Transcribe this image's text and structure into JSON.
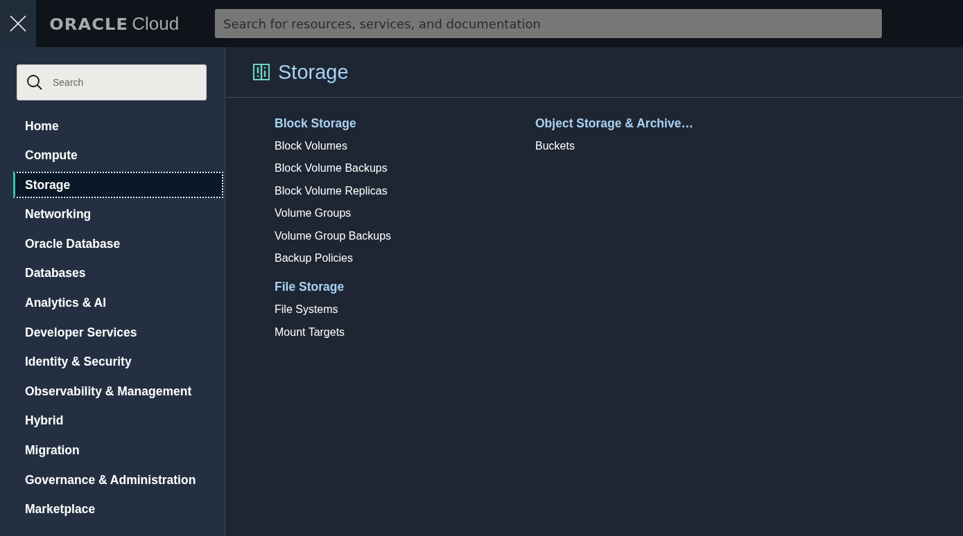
{
  "header": {
    "logo": "ORACLE",
    "product": "Cloud",
    "search": {
      "placeholder": "Search for resources, services, and documentation"
    }
  },
  "sidebar": {
    "search": {
      "placeholder": "Search"
    },
    "items": [
      {
        "label": "Home",
        "selected": false
      },
      {
        "label": "Compute",
        "selected": false
      },
      {
        "label": "Storage",
        "selected": true
      },
      {
        "label": "Networking",
        "selected": false
      },
      {
        "label": "Oracle Database",
        "selected": false
      },
      {
        "label": "Databases",
        "selected": false
      },
      {
        "label": "Analytics & AI",
        "selected": false
      },
      {
        "label": "Developer Services",
        "selected": false
      },
      {
        "label": "Identity & Security",
        "selected": false
      },
      {
        "label": "Observability & Management",
        "selected": false
      },
      {
        "label": "Hybrid",
        "selected": false
      },
      {
        "label": "Migration",
        "selected": false
      },
      {
        "label": "Governance & Administration",
        "selected": false
      },
      {
        "label": "Marketplace",
        "selected": false
      }
    ]
  },
  "main": {
    "title": "Storage",
    "columns": [
      {
        "groups": [
          {
            "heading": "Block Storage",
            "links": [
              "Block Volumes",
              "Block Volume Backups",
              "Block Volume Replicas",
              "Volume Groups",
              "Volume Group Backups",
              "Backup Policies"
            ]
          },
          {
            "heading": "File Storage",
            "links": [
              "File Systems",
              "Mount Targets"
            ]
          }
        ]
      },
      {
        "groups": [
          {
            "heading": "Object Storage & Archive…",
            "links": [
              "Buckets"
            ]
          }
        ]
      }
    ]
  }
}
